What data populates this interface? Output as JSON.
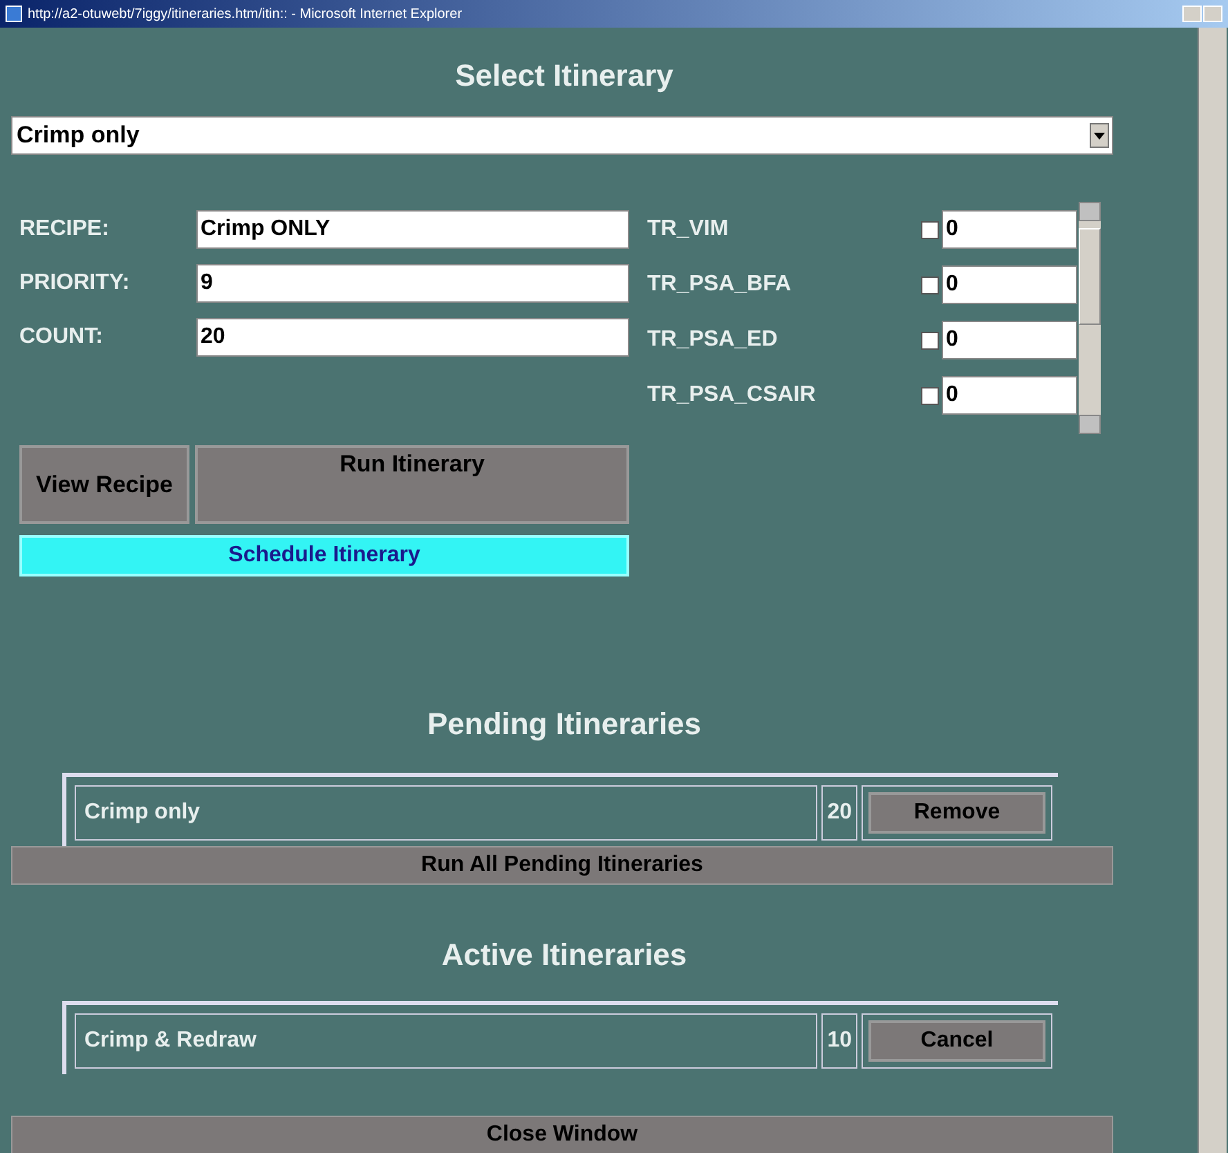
{
  "window": {
    "title": "http://a2-otuwebt/7iggy/itineraries.htm/itin:: - Microsoft Internet Explorer"
  },
  "select_itinerary": {
    "heading": "Select Itinerary",
    "dropdown": {
      "value": "Crimp only"
    },
    "fields": [
      {
        "label": "RECIPE:",
        "value": "Crimp ONLY"
      },
      {
        "label": "PRIORITY:",
        "value": "9"
      },
      {
        "label": "COUNT:",
        "value": "20"
      }
    ],
    "options": [
      {
        "label": "TR_VIM",
        "checked": false,
        "value": "0"
      },
      {
        "label": "TR_PSA_BFA",
        "checked": false,
        "value": "0"
      },
      {
        "label": "TR_PSA_ED",
        "checked": false,
        "value": "0"
      },
      {
        "label": "TR_PSA_CSAIR",
        "checked": false,
        "value": "0"
      }
    ],
    "buttons": {
      "view_recipe": "View Recipe",
      "run": "Run Itinerary",
      "schedule": "Schedule Itinerary"
    }
  },
  "pending": {
    "heading": "Pending Itineraries",
    "rows": [
      {
        "name": "Crimp only",
        "count": "20",
        "action": "Remove"
      }
    ],
    "run_all": "Run All Pending Itineraries"
  },
  "active": {
    "heading": "Active Itineraries",
    "rows": [
      {
        "name": "Crimp & Redraw",
        "count": "10",
        "action": "Cancel"
      }
    ]
  },
  "close": "Close Window"
}
